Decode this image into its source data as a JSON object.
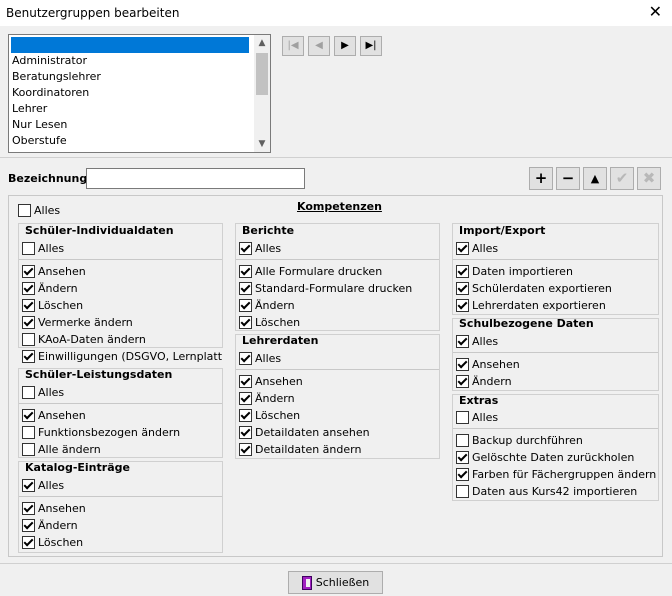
{
  "window": {
    "title": "Benutzergruppen bearbeiten",
    "close": "✕"
  },
  "groups_list": {
    "items": [
      "",
      "Administrator",
      "Beratungslehrer",
      "Koordinatoren",
      "Lehrer",
      "Nur Lesen",
      "Oberstufe"
    ]
  },
  "nav": {
    "first": "|◀",
    "prev": "◀",
    "next": "▶",
    "last": "▶|"
  },
  "form": {
    "bezeichnung_label": "Bezeichnung",
    "bezeichnung_value": ""
  },
  "toolbar": {
    "add": "+",
    "remove": "−",
    "up": "▲",
    "ok": "✔",
    "cancel": "✖"
  },
  "kompetenzen": {
    "all_label": "Alles",
    "title": "Kompetenzen",
    "schueler_individual": {
      "title": "Schüler-Individualdaten",
      "all": "Alles",
      "items": [
        "Ansehen",
        "Ändern",
        "Löschen",
        "Vermerke ändern",
        "KAoA-Daten ändern",
        "Einwilligungen (DSGVO, Lernplattforme"
      ]
    },
    "schueler_leistung": {
      "title": "Schüler-Leistungsdaten",
      "all": "Alles",
      "items": [
        "Ansehen",
        "Funktionsbezogen ändern",
        "Alle ändern"
      ]
    },
    "katalog": {
      "title": "Katalog-Einträge",
      "all": "Alles",
      "items": [
        "Ansehen",
        "Ändern",
        "Löschen"
      ]
    },
    "berichte": {
      "title": "Berichte",
      "all": "Alles",
      "items": [
        "Alle Formulare drucken",
        "Standard-Formulare drucken",
        "Ändern",
        "Löschen"
      ]
    },
    "lehrerdaten": {
      "title": "Lehrerdaten",
      "all": "Alles",
      "items": [
        "Ansehen",
        "Ändern",
        "Löschen",
        "Detaildaten ansehen",
        "Detaildaten ändern"
      ]
    },
    "import_export": {
      "title": "Import/Export",
      "all": "Alles",
      "items": [
        "Daten importieren",
        "Schülerdaten exportieren",
        "Lehrerdaten exportieren"
      ]
    },
    "schulbezogen": {
      "title": "Schulbezogene Daten",
      "all": "Alles",
      "items": [
        "Ansehen",
        "Ändern"
      ]
    },
    "extras": {
      "title": "Extras",
      "all": "Alles",
      "items": [
        "Backup durchführen",
        "Gelöschte Daten zurückholen",
        "Farben für Fächergruppen ändern",
        "Daten aus Kurs42 importieren"
      ]
    }
  },
  "footer": {
    "close_label": "Schließen"
  }
}
